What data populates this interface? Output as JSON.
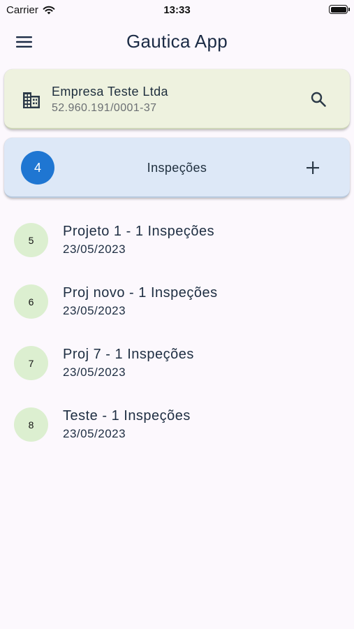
{
  "status_bar": {
    "carrier": "Carrier",
    "time": "13:33"
  },
  "app_bar": {
    "title": "Gautica App",
    "menu_icon": "menu-icon"
  },
  "company": {
    "name": "Empresa Teste Ltda",
    "cnpj": "52.960.191/0001-37",
    "icon": "building-icon",
    "search_icon": "search-icon"
  },
  "inspections": {
    "count": "4",
    "label": "Inspeções",
    "add_icon": "plus-icon"
  },
  "projects": [
    {
      "number": "5",
      "title": "Projeto 1 - 1 Inspeções",
      "date": "23/05/2023"
    },
    {
      "number": "6",
      "title": "Proj novo - 1 Inspeções",
      "date": "23/05/2023"
    },
    {
      "number": "7",
      "title": "Proj 7 - 1 Inspeções",
      "date": "23/05/2023"
    },
    {
      "number": "8",
      "title": "Teste - 1 Inspeções",
      "date": "23/05/2023"
    }
  ],
  "colors": {
    "background": "#fcf8fd",
    "company_card": "#eef2df",
    "inspections_card": "#dde8f7",
    "badge": "#1f76d2",
    "avatar": "#dcefd0"
  }
}
